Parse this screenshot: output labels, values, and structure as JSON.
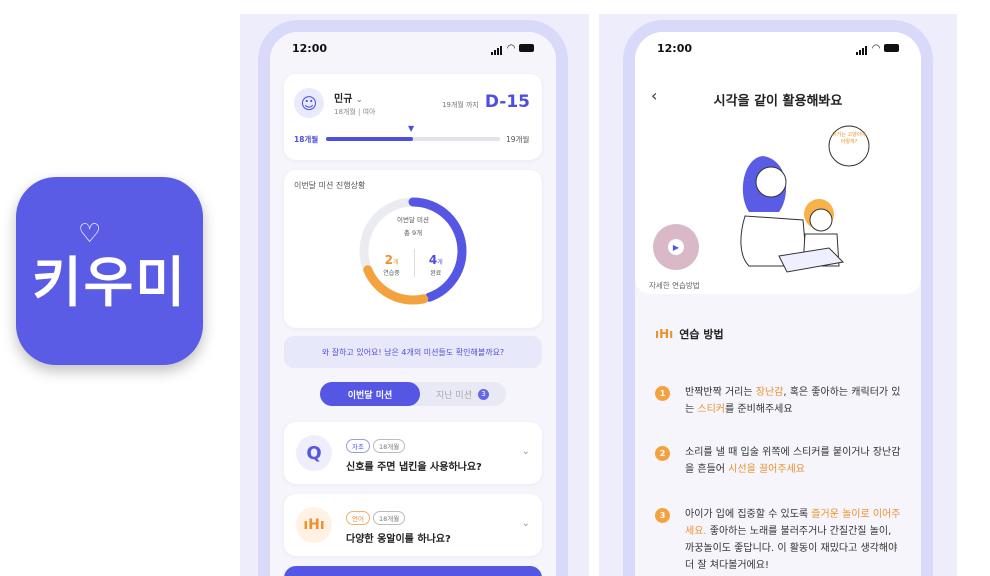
{
  "app_icon": {
    "logo": "키우미"
  },
  "left_phone": {
    "status_time": "12:00",
    "profile": {
      "name": "민규",
      "sub": "18개월 | 여아",
      "dday_label": "19개월 까지",
      "dday": "D-15",
      "progress_start": "18개월",
      "progress_end": "19개월",
      "progress_fraction": 0.5
    },
    "mission_status": {
      "title": "이번달 미션 진행상황",
      "center_label": "이번달 미션",
      "center_total": "총 9개",
      "in_progress_value": "2",
      "in_progress_unit": "개",
      "in_progress_label": "연습중",
      "done_value": "4",
      "done_unit": "개",
      "done_label": "완료"
    },
    "encourage": "와 잘하고 있어요! 남은 4개의 미션들도 확인해볼까요?",
    "tabs": {
      "current": "이번달 미션",
      "past": "지난 미션",
      "past_count": "3"
    },
    "missions": [
      {
        "icon": "Q",
        "tags": [
          "자조",
          "18개월"
        ],
        "title": "신호를 주면 냅킨을 사용하나요?"
      },
      {
        "icon": "barbell-icon",
        "tags": [
          "언어",
          "18개월"
        ],
        "title": "다양한 옹알이를 하나요?"
      }
    ]
  },
  "right_phone": {
    "status_time": "12:00",
    "title": "시각을 같이 활용해봐요",
    "illustration_bubble": "이거는 고양이야 어떻게?",
    "video_label": "자세한 연습방법",
    "section_title": "연습 방법",
    "steps": [
      {
        "num": "1",
        "p1": "반짝반짝 거리는 ",
        "h1": "장난감",
        "p2": ", 혹은 좋아하는 캐릭터가 있는 ",
        "h2": "스티커",
        "p3": "를 준비해주세요"
      },
      {
        "num": "2",
        "p1": "소리를 낼 때 입술 위쪽에 스티커를 붙이거나 장난감을 흔들어 ",
        "h1": "시선을 끌어주세요",
        "p2": "",
        "h2": "",
        "p3": ""
      },
      {
        "num": "3",
        "p1": "아이가 입에 집중할 수 있도록 ",
        "h1": "즐거운 놀이로 이어주세요.",
        "p2": " 좋아하는 노래를 불러주거나 간질간질 놀이, 까꿍놀이도 좋답니다. 이 활동이 재밌다고 생각해야 더 잘 쳐다볼거에요!",
        "h2": "",
        "p3": ""
      }
    ]
  },
  "colors": {
    "brand": "#5b5ce6",
    "accent_orange": "#f3a23d"
  }
}
